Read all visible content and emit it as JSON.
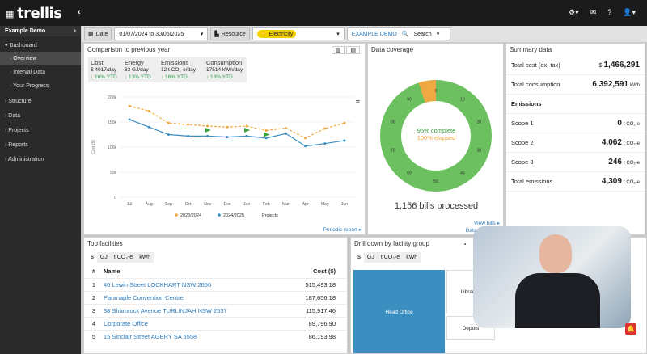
{
  "topbar": {
    "logo": "trellis"
  },
  "sidebar": {
    "account": "Example Demo",
    "items": [
      {
        "label": "Dashboard"
      },
      {
        "label": "Overview"
      },
      {
        "label": "Interval Data"
      },
      {
        "label": "Your Progress"
      },
      {
        "label": "Structure"
      },
      {
        "label": "Data"
      },
      {
        "label": "Projects"
      },
      {
        "label": "Reports"
      },
      {
        "label": "Administration"
      }
    ]
  },
  "filters": {
    "date_label": "Date",
    "date_value": "01/07/2024 to 30/06/2025",
    "resource_label": "Resource",
    "resource_value": "Electricity",
    "demo_label": "EXAMPLE DEMO",
    "search_label": "Search"
  },
  "comparison": {
    "title": "Comparison to previous year",
    "metrics": [
      {
        "head": "Cost",
        "value": "$ 4017/day",
        "ytd": "↓ 16% YTD"
      },
      {
        "head": "Energy",
        "value": "63 GJ/day",
        "ytd": "↓ 13% YTD"
      },
      {
        "head": "Emissions",
        "value": "12 t CO₂-e/day",
        "ytd": "↓ 16% YTD"
      },
      {
        "head": "Consumption",
        "value": "17514 kWh/day",
        "ytd": "↓ 13% YTD"
      }
    ],
    "ylabel": "Cost ($)",
    "legend": [
      "2023/2024",
      "2024/2025",
      "Projects"
    ],
    "link": "Periodic report ▸"
  },
  "chart_data": {
    "type": "line",
    "categories": [
      "Jul",
      "Aug",
      "Sep",
      "Oct",
      "Nov",
      "Dec",
      "Jan",
      "Feb",
      "Mar",
      "Apr",
      "May",
      "Jun"
    ],
    "ylabel": "Cost ($)",
    "ylim": [
      0,
      200000
    ],
    "yticks": [
      "0",
      "50k",
      "100k",
      "150k",
      "200k"
    ],
    "series": [
      {
        "name": "2023/2024",
        "values": [
          182000,
          172000,
          148000,
          145000,
          142000,
          140000,
          142000,
          133000,
          138000,
          118000,
          137000,
          148000
        ]
      },
      {
        "name": "2024/2025",
        "values": [
          155000,
          140000,
          125000,
          122000,
          122000,
          120000,
          122000,
          118000,
          127000,
          102000,
          107000,
          113000
        ]
      }
    ],
    "projects_markers": [
      "Nov",
      "Jan",
      "Feb"
    ]
  },
  "coverage": {
    "title": "Data coverage",
    "complete": "95% complete",
    "elapsed": "100% elapsed",
    "bills": "1,156 bills processed",
    "view": "View bills ▸",
    "link": "Data coverage",
    "ticks": [
      "0",
      "10",
      "20",
      "30",
      "40",
      "50",
      "60",
      "70",
      "80",
      "90"
    ]
  },
  "summary": {
    "title": "Summary data",
    "rows": [
      {
        "label": "Total cost (ex. tax)",
        "prefix": "$",
        "value": "1,466,291",
        "unit": ""
      },
      {
        "label": "Total consumption",
        "prefix": "",
        "value": "6,392,591",
        "unit": "kWh"
      }
    ],
    "emissions_title": "Emissions",
    "erows": [
      {
        "label": "Scope 1",
        "value": "0",
        "unit": "t CO₂-e"
      },
      {
        "label": "Scope 2",
        "value": "4,062",
        "unit": "t CO₂-e"
      },
      {
        "label": "Scope 3",
        "value": "246",
        "unit": "t CO₂-e"
      },
      {
        "label": "Total emissions",
        "value": "4,309",
        "unit": "t CO₂-e"
      }
    ]
  },
  "facilities": {
    "title": "Top facilities",
    "tabs": [
      "$",
      "GJ",
      "t CO₂-e",
      "kWh"
    ],
    "col_name": "Name",
    "col_cost": "Cost ($)",
    "rows": [
      {
        "n": "1",
        "name": "46 Lewin Street LOCKHART NSW 2656",
        "cost": "515,493.18"
      },
      {
        "n": "2",
        "name": "Paranaple Convention Centre",
        "cost": "187,656.18"
      },
      {
        "n": "3",
        "name": "38 Shamrock Avenue TURLINJAH NSW 2537",
        "cost": "115,917.46"
      },
      {
        "n": "4",
        "name": "Corporate Office",
        "cost": "89,796.90"
      },
      {
        "n": "5",
        "name": "15 Sinclair Street AGERY SA 5558",
        "cost": "86,193.98"
      }
    ]
  },
  "drill": {
    "title": "Drill down by facility group",
    "tabs": [
      "$",
      "GJ",
      "t CO₂-e",
      "kWh"
    ],
    "head_office": "Head Office",
    "libraries": "Libraries",
    "depots": "Depots"
  }
}
